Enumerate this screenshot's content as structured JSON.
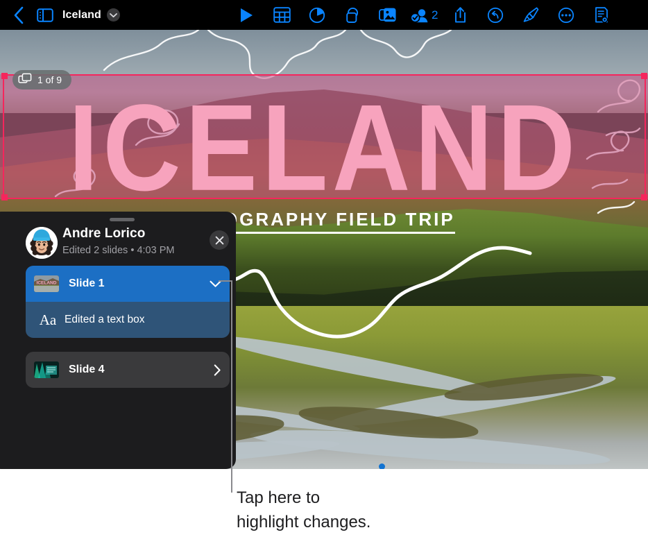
{
  "app": {
    "document_title": "Iceland",
    "document_chevron_icon": "chevron-down-icon"
  },
  "toolbar": {
    "back_icon": "chevron-left-back-icon",
    "sidebar_icon": "sidebar-toggle-icon",
    "items": [
      {
        "name": "play-button",
        "icon": "play-triangle-icon",
        "label": "Play"
      },
      {
        "name": "table-button",
        "icon": "table-grid-icon",
        "label": "Table"
      },
      {
        "name": "chart-button",
        "icon": "pie-chart-icon",
        "label": "Chart"
      },
      {
        "name": "shape-button",
        "icon": "shapes-overlap-icon",
        "label": "Shape"
      },
      {
        "name": "media-button",
        "icon": "photos-stack-icon",
        "label": "Media"
      },
      {
        "name": "collaborate-button",
        "icon": "collaborate-person-check-icon",
        "label": "Collaborate"
      },
      {
        "name": "share-button",
        "icon": "share-up-arrow-icon",
        "label": "Share"
      },
      {
        "name": "undo-button",
        "icon": "undo-circle-arrow-icon",
        "label": "Undo"
      },
      {
        "name": "format-button",
        "icon": "paintbrush-icon",
        "label": "Format"
      },
      {
        "name": "more-button",
        "icon": "ellipsis-circle-icon",
        "label": "More"
      },
      {
        "name": "document-options-button",
        "icon": "document-gear-icon",
        "label": "Document Options"
      }
    ],
    "collaborator_count": "2"
  },
  "slide_badge": {
    "icon": "slides-stack-icon",
    "text": "1 of 9"
  },
  "slide": {
    "title": "ICELAND",
    "subtitle": "GEOGRAPHY FIELD TRIP",
    "selection_color": "#f5265c",
    "title_color": "#f7a3bd",
    "overlay_color": "rgba(198,78,130,0.52)"
  },
  "activity_panel": {
    "grabber": "drag-handle",
    "author": "Andre Lorico",
    "meta": "Edited 2 slides • 4:03 PM",
    "close_icon": "close-x-icon",
    "entries": [
      {
        "label": "Slide 1",
        "thumbnail": "slide-1-thumbnail",
        "chevron_icon": "chevron-down-icon",
        "expanded": true,
        "changes": [
          {
            "icon": "text-box-aa-icon",
            "icon_text": "Aa",
            "text": "Edited a text box"
          }
        ]
      },
      {
        "label": "Slide 4",
        "thumbnail": "slide-4-thumbnail",
        "chevron_icon": "chevron-right-icon",
        "expanded": false,
        "changes": []
      }
    ]
  },
  "callout": {
    "line1": "Tap here to",
    "line2": "highlight changes."
  },
  "colors": {
    "accent_blue": "#0a84ff",
    "row_selected_blue": "#1c6fc4",
    "row_sub_blue": "#2f5478",
    "panel_bg": "#1c1c1e",
    "toolbar_bg": "#000000"
  }
}
